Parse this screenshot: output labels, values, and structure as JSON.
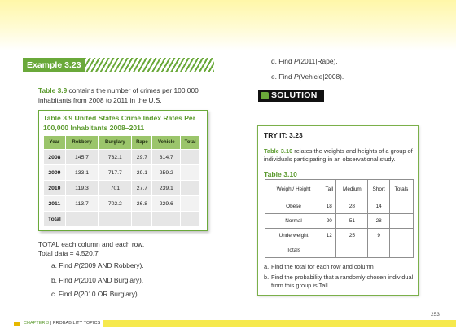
{
  "example": {
    "label": "Example 3.23"
  },
  "intro": {
    "ref": "Table 3.9",
    "text": " contains the number of crimes per 100,000 inhabitants from 2008 to 2011 in the U.S."
  },
  "crime_table": {
    "title": "Table 3.9 United States Crime Index Rates Per 100,000 Inhabitants 2008–2011",
    "headers": [
      "Year",
      "Robbery",
      "Burglary",
      "Rape",
      "Vehicle",
      "Total"
    ],
    "rows": [
      [
        "2008",
        "145.7",
        "732.1",
        "29.7",
        "314.7",
        ""
      ],
      [
        "2009",
        "133.1",
        "717.7",
        "29.1",
        "259.2",
        ""
      ],
      [
        "2010",
        "119.3",
        "701",
        "27.7",
        "239.1",
        ""
      ],
      [
        "2011",
        "113.7",
        "702.2",
        "26.8",
        "229.6",
        ""
      ],
      [
        "Total",
        "",
        "",
        "",
        "",
        ""
      ]
    ]
  },
  "instructions": {
    "line1": "TOTAL each column and each row.",
    "line2": "Total data = 4,520.7"
  },
  "questions_left": [
    {
      "prefix": "a. Find ",
      "p": "P",
      "rest": "(2009 AND Robbery)."
    },
    {
      "prefix": "b. Find ",
      "p": "P",
      "rest": "(2010 AND Burglary)."
    },
    {
      "prefix": "c. Find ",
      "p": "P",
      "rest": "(2010 OR Burglary)."
    }
  ],
  "questions_right": [
    {
      "prefix": "d. Find ",
      "p": "P",
      "rest": "(2011|Rape)."
    },
    {
      "prefix": "e. Find ",
      "p": "P",
      "rest": "(Vehicle|2008)."
    }
  ],
  "solution": {
    "label": "SOLUTION"
  },
  "try_it": {
    "title": "TRY IT: 3.23",
    "ref": "Table 3.10",
    "text": " relates the weights and heights of a group of individuals participating in an observational study.",
    "table_label": "Table 3.10",
    "headers": [
      "Weight/ Height",
      "Tall",
      "Medium",
      "Short",
      "Totals"
    ],
    "rows": [
      [
        "Obese",
        "18",
        "28",
        "14",
        ""
      ],
      [
        "Normal",
        "20",
        "51",
        "28",
        ""
      ],
      [
        "Underweight",
        "12",
        "25",
        "9",
        ""
      ],
      [
        "Totals",
        "",
        "",
        "",
        ""
      ]
    ],
    "questions": [
      {
        "num": "a.",
        "text": "Find the total for each row and column"
      },
      {
        "num": "b.",
        "text": "Find the probability that a randomly chosen individual from this group is Tall."
      }
    ]
  },
  "page_number": "253",
  "footer": {
    "chapter": "CHAPTER 3",
    "title": " | PROBABILITY TOPICS"
  }
}
